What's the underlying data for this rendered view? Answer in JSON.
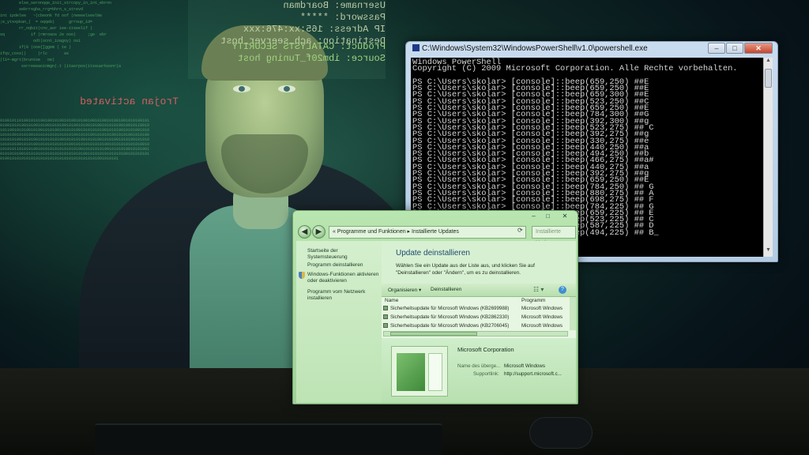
{
  "background": {
    "credentials_text": "Username: Boardman\nPassword: *****\nIP Adress: 165:xx:476:xxx\nDestination: ach_seerver_host",
    "product_text": "Product: CATALYSTS SECURITY\nSource: ibm20f_Tuning host",
    "trojan_text": "Trojan activated",
    "code_lines": "        else_seronqqe_init_strcopy_in_int_ebrnn\n        sebrrsgba_rrg=bhrn_s_strevd\nint ipdelee   ~(cbeonk fd oof (neeeelseelNe\n;e_ytsxpkan_(  = oqqeb)      grroup_id=\n        rr_oqbit(cnv_aor iee-itseelif )\nsq           if (rmroaos 2e ooo)     ;ge  ebr\n              odt(ocnt_ioagoy) osi\n        if(0 (ooe{]ggem ( te )\nifqv_coxs()     (rlc       as\n(l1=-mgrt(bruntoe   oe)\n         ssrreeeaoinmgn(.t (itasrpos(itssuarkesnr(a\n",
    "binary_text": "01001011010010101001001010010100101001001010010100100101010010101001010100101001010010101001010010100101001010101001001011001010110010101001010010101001010101001010101010010101001010100101010101001010100101010101010101010010101001010101001010100101010010101010010101001010101010010101010010101001010100101010010101010101010010101001010101010101001010101010101001010101010101001010101011010101001010101010101010100101010101001010101001010100101010101001010101010101010101010101001010101010101010010101010101001010101010101010101010101010101010101001010101"
  },
  "powershell": {
    "title": "C:\\Windows\\System32\\WindowsPowerShell\\v1.0\\powershell.exe",
    "controls": {
      "minimize": "–",
      "maximize": "□",
      "close": "✕"
    },
    "console_text": "Windows PowerShell\nCopyright (C) 2009 Microsoft Corporation. Alle Rechte vorbehalten.\n\nPS C:\\Users\\skolar> [console]::beep(659,250) ##E\nPS C:\\Users\\skolar> [console]::beep(659,250) ##E\nPS C:\\Users\\skolar> [console]::beep(659,300) ##E\nPS C:\\Users\\skolar> [console]::beep(523,250) ##C\nPS C:\\Users\\skolar> [console]::beep(659,250) ##E\nPS C:\\Users\\skolar> [console]::beep(784,300) ##G\nPS C:\\Users\\skolar> [console]::beep(392,300) ##g\nPS C:\\Users\\skolar> [console]::beep(523,275) ## C\nPS C:\\Users\\skolar> [console]::beep(392,275) ##g\nPS C:\\Users\\skolar> [console]::beep(330,275) ##e\nPS C:\\Users\\skolar> [console]::beep(440,250) ##a\nPS C:\\Users\\skolar> [console]::beep(494,250) ##b\nPS C:\\Users\\skolar> [console]::beep(466,275) ##a#\nPS C:\\Users\\skolar> [console]::beep(440,275) ##a\nPS C:\\Users\\skolar> [console]::beep(392,275) ##g\nPS C:\\Users\\skolar> [console]::beep(659,250) ##E\nPS C:\\Users\\skolar> [console]::beep(784,250) ## G\nPS C:\\Users\\skolar> [console]::beep(880,275) ## A\nPS C:\\Users\\skolar> [console]::beep(698,275) ## F\nPS C:\\Users\\skolar> [console]::beep(784,225) ## G\nPS C:\\Users\\skolar> [console]::beep(659,225) ## E\nPS C:\\Users\\skolar> [console]::beep(523,225) ## C\nPS C:\\Users\\skolar> [console]::beep(587,225) ## D\nPS C:\\Users\\skolar> [console]::beep(494,225) ## B_"
  },
  "control_panel": {
    "window_controls": {
      "minimize": "–",
      "maximize": "□",
      "close": "✕"
    },
    "breadcrumb": "«  Programme und Funktionen  ▸  Installierte Updates",
    "search_placeholder": "Installierte Upd...",
    "left_links": [
      "Startseite der Systemsteuerung",
      "Programm deinstallieren",
      "Windows-Funktionen aktivieren oder deaktivieren",
      "Programm vom Netzwerk installieren"
    ],
    "heading": "Update deinstallieren",
    "description": "Wählen Sie ein Update aus der Liste aus, und klicken Sie auf \"Deinstallieren\" oder \"Ändern\", um es zu deinstallieren.",
    "toolbar": {
      "organize": "Organisieren  ▾",
      "uninstall": "Deinstallieren"
    },
    "columns": {
      "name": "Name",
      "program": "Programm"
    },
    "rows": [
      {
        "name": "Sicherheitsupdate für Microsoft Windows (KB2699988)",
        "program": "Microsoft Windows"
      },
      {
        "name": "Sicherheitsupdate für Microsoft Windows (KB2862330)",
        "program": "Microsoft Windows"
      },
      {
        "name": "Sicherheitsupdate für Microsoft Windows (KB2706045)",
        "program": "Microsoft Windows"
      }
    ],
    "details": {
      "publisher": "Microsoft Corporation",
      "parent_label": "Name des überge...",
      "parent_value": "Microsoft Windows",
      "support_label": "Supportlink:",
      "support_value": "http://support.microsoft.c..."
    }
  }
}
